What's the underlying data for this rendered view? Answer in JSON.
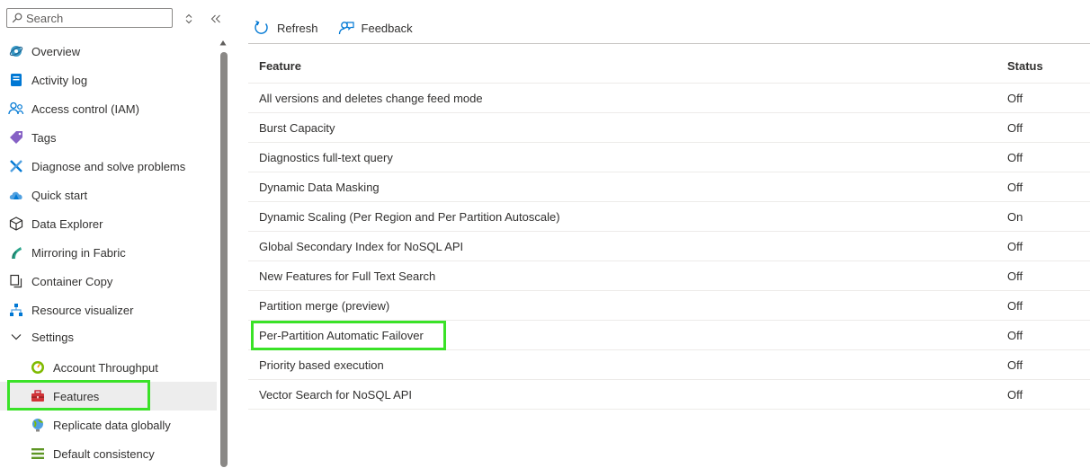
{
  "sidebar": {
    "search_placeholder": "Search",
    "items": [
      {
        "label": "Overview"
      },
      {
        "label": "Activity log"
      },
      {
        "label": "Access control (IAM)"
      },
      {
        "label": "Tags"
      },
      {
        "label": "Diagnose and solve problems"
      },
      {
        "label": "Quick start"
      },
      {
        "label": "Data Explorer"
      },
      {
        "label": "Mirroring in Fabric"
      },
      {
        "label": "Container Copy"
      },
      {
        "label": "Resource visualizer"
      },
      {
        "label": "Settings"
      }
    ],
    "settings_items": [
      {
        "label": "Account Throughput"
      },
      {
        "label": "Features"
      },
      {
        "label": "Replicate data globally"
      },
      {
        "label": "Default consistency"
      }
    ]
  },
  "toolbar": {
    "refresh_label": "Refresh",
    "feedback_label": "Feedback"
  },
  "table": {
    "headers": [
      "Feature",
      "Status"
    ],
    "rows": [
      [
        "All versions and deletes change feed mode",
        "Off"
      ],
      [
        "Burst Capacity",
        "Off"
      ],
      [
        "Diagnostics full-text query",
        "Off"
      ],
      [
        "Dynamic Data Masking",
        "Off"
      ],
      [
        "Dynamic Scaling (Per Region and Per Partition Autoscale)",
        "On"
      ],
      [
        "Global Secondary Index for NoSQL API",
        "Off"
      ],
      [
        "New Features for Full Text Search",
        "Off"
      ],
      [
        "Partition merge (preview)",
        "Off"
      ],
      [
        "Per-Partition Automatic Failover",
        "Off"
      ],
      [
        "Priority based execution",
        "Off"
      ],
      [
        "Vector Search for NoSQL API",
        "Off"
      ]
    ]
  },
  "colors": {
    "highlight": "#3ae227",
    "selected_bg": "#ededed"
  }
}
